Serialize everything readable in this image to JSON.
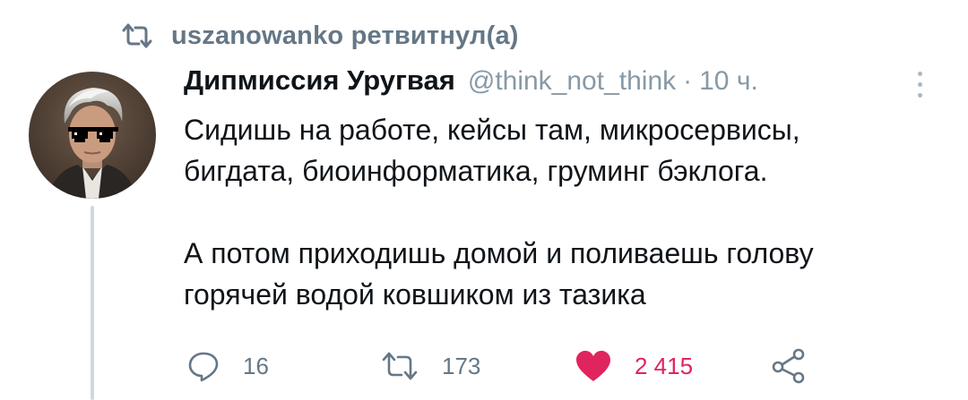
{
  "retweet_header": {
    "text": "uszanowanko ретвитнул(а)",
    "icon": "retweet-icon"
  },
  "author": {
    "name": "Дипмиссия Уругвая",
    "handle": "@think_not_think",
    "separator": "·",
    "time": "10 ч.",
    "avatar": "avatar-image"
  },
  "tweet": {
    "paragraph_1_line_1": "Сидишь на работе, кейсы там, микросервисы,",
    "paragraph_1_line_2": "бигдата, биоинформатика, груминг бэклога.",
    "paragraph_2_line_1": "А потом приходишь домой и поливаешь голову",
    "paragraph_2_line_2": "горячей водой ковшиком из тазика"
  },
  "actions": {
    "reply": {
      "icon": "reply-icon",
      "count": "16"
    },
    "retweet": {
      "icon": "retweet-icon",
      "count": "173"
    },
    "like": {
      "icon": "heart-icon",
      "count": "2 415",
      "color": "#e0245e"
    },
    "share": {
      "icon": "share-icon"
    }
  },
  "colors": {
    "secondary_text": "#657786",
    "muted": "#8899a6",
    "like": "#e0245e"
  }
}
